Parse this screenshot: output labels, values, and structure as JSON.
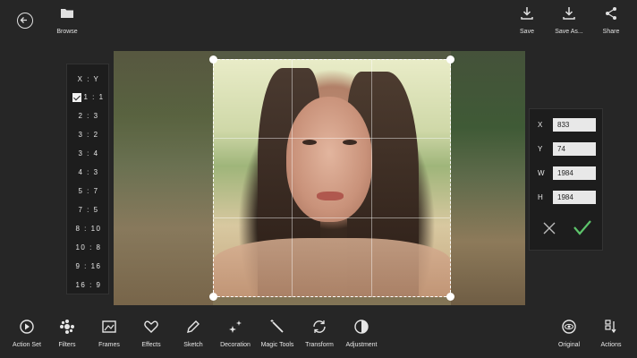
{
  "top_bar": {
    "browse_label": "Browse",
    "save_label": "Save",
    "save_as_label": "Save As...",
    "share_label": "Share"
  },
  "ratios": {
    "header": "X : Y",
    "items": [
      "1 : 1",
      "2 : 3",
      "3 : 2",
      "3 : 4",
      "4 : 3",
      "5 : 7",
      "7 : 5",
      "8 : 10",
      "10 : 8",
      "9 : 16",
      "16 : 9"
    ],
    "selected": "1 : 1"
  },
  "coords": {
    "x_label": "X",
    "x_value": "833",
    "y_label": "Y",
    "y_value": "74",
    "w_label": "W",
    "w_value": "1984",
    "h_label": "H",
    "h_value": "1984"
  },
  "toolbar": {
    "action_set": "Action Set",
    "filters": "Filters",
    "frames": "Frames",
    "effects": "Effects",
    "sketch": "Sketch",
    "decoration": "Decoration",
    "magic_tools": "Magic Tools",
    "transform": "Transform",
    "adjustment": "Adjustment",
    "original": "Original",
    "actions": "Actions"
  },
  "colors": {
    "background": "#262626",
    "panel": "#1d1d1d",
    "confirm_green": "#5dc46b"
  },
  "icons": [
    "back-icon",
    "folder-icon",
    "download-icon",
    "share-icon",
    "checkmark-icon",
    "close-icon"
  ]
}
